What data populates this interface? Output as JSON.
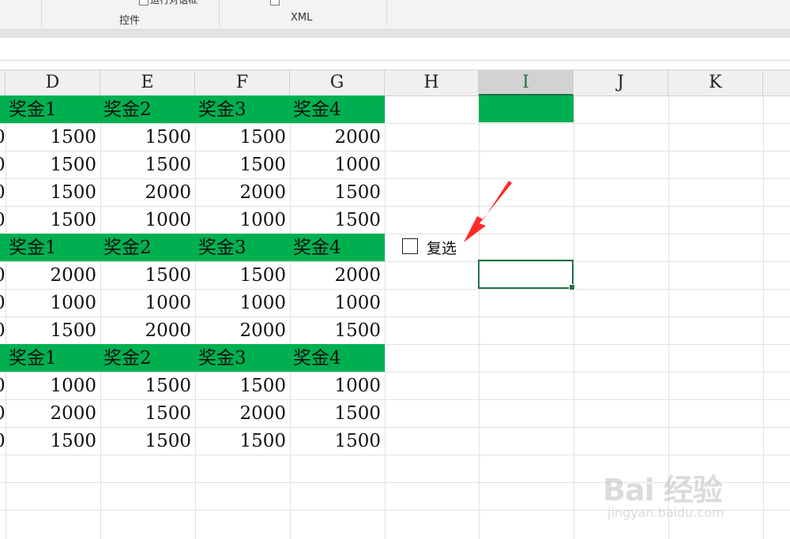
{
  "ribbon": {
    "clipped_button_label": "运行对话框",
    "groups": [
      {
        "label": "控件"
      },
      {
        "label": "XML"
      }
    ]
  },
  "columns": [
    "D",
    "E",
    "F",
    "G",
    "H",
    "I",
    "J",
    "K"
  ],
  "selected_column": "I",
  "table": {
    "sections": [
      {
        "header": [
          "奖金1",
          "奖金2",
          "奖金3",
          "奖金4"
        ],
        "rows": [
          [
            "1500",
            "1500",
            "1500",
            "2000"
          ],
          [
            "1500",
            "1500",
            "1500",
            "1000"
          ],
          [
            "1500",
            "2000",
            "2000",
            "1500"
          ],
          [
            "1500",
            "1000",
            "1000",
            "1500"
          ]
        ]
      },
      {
        "header": [
          "奖金1",
          "奖金2",
          "奖金3",
          "奖金4"
        ],
        "rows": [
          [
            "2000",
            "1500",
            "1500",
            "2000"
          ],
          [
            "1000",
            "1000",
            "1000",
            "1000"
          ],
          [
            "1500",
            "2000",
            "2000",
            "1500"
          ]
        ]
      },
      {
        "header": [
          "奖金1",
          "奖金2",
          "奖金3",
          "奖金4"
        ],
        "rows": [
          [
            "1000",
            "1500",
            "1500",
            "1000"
          ],
          [
            "2000",
            "1500",
            "2000",
            "1500"
          ],
          [
            "1500",
            "1500",
            "1500",
            "1500"
          ]
        ]
      }
    ],
    "left_edge_fragment": "0"
  },
  "checkbox": {
    "label": "复选",
    "checked": false
  },
  "colors": {
    "header_green": "#00b050",
    "selection_green": "#217346",
    "arrow_red": "#ff2a2a"
  },
  "icons": [
    "checkbox-icon",
    "red-arrow-annotation"
  ],
  "watermark": {
    "main": "Bai 经验",
    "sub": "jingyan.baidu.com"
  }
}
